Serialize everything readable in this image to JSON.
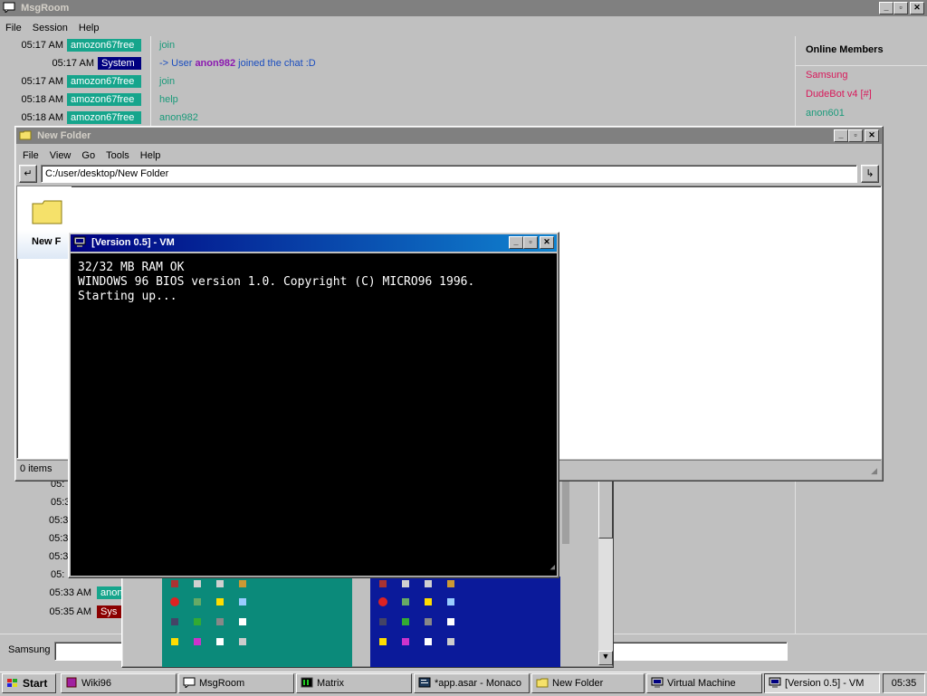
{
  "msgroom": {
    "title": "MsgRoom",
    "menu": [
      "File",
      "Session",
      "Help"
    ],
    "messages": [
      {
        "time": "05:17 AM",
        "user": "amozon67free",
        "text": "join"
      },
      {
        "time": "05:17 AM",
        "user": "System",
        "text_prefix": "-> User ",
        "text_user": "anon982",
        "text_suffix": " joined the chat :D"
      },
      {
        "time": "05:17 AM",
        "user": "amozon67free",
        "text": "join"
      },
      {
        "time": "05:18 AM",
        "user": "amozon67free",
        "text": "help"
      },
      {
        "time": "05:18 AM",
        "user": "amozon67free",
        "text": "anon982"
      }
    ],
    "partial_times": [
      "05:",
      "05:3",
      "05:3",
      "05:3",
      "05:3",
      "05:"
    ],
    "bottom_messages": [
      {
        "time": "05:33 AM",
        "user": "anon"
      },
      {
        "time": "05:35 AM",
        "user": "Sys"
      }
    ],
    "online_title": "Online Members",
    "members": [
      {
        "name": "Samsung",
        "color": "#d8185a"
      },
      {
        "name": "DudeBot v4 [#]",
        "color": "#d8185a"
      },
      {
        "name": "anon601",
        "color": "#1a9a7a"
      }
    ],
    "input_label": "Samsung",
    "colors": {
      "user_bg": "#16a58c",
      "system_bg": "#000080",
      "system2_bg": "#8b0000",
      "msg": "#1a9a7a",
      "highlight_user": "#8b1ab0"
    }
  },
  "explorer": {
    "title": "New Folder",
    "menu": [
      "File",
      "View",
      "Go",
      "Tools",
      "Help"
    ],
    "path": "C:/user/desktop/New Folder",
    "back_icon": "back-arrow-icon",
    "go_icon": "go-arrow-icon",
    "folder_label": "New F",
    "status": "0 items"
  },
  "vm": {
    "title": "[Version 0.5] - VM",
    "console": [
      "32/32 MB RAM OK",
      "WINDOWS 96 BIOS version 1.0. Copyright (C) MICRO96 1996.",
      "Starting up..."
    ]
  },
  "taskbar": {
    "start": "Start",
    "items": [
      {
        "label": "Wiki96",
        "icon": "wiki-icon"
      },
      {
        "label": "MsgRoom",
        "icon": "chat-icon"
      },
      {
        "label": "Matrix",
        "icon": "matrix-icon"
      },
      {
        "label": "*app.asar - Monaco",
        "icon": "editor-icon"
      },
      {
        "label": "New Folder",
        "icon": "folder-icon"
      },
      {
        "label": "Virtual Machine",
        "icon": "vm-icon"
      },
      {
        "label": "[Version 0.5] - VM",
        "icon": "vm-icon"
      }
    ],
    "clock": "05:35"
  }
}
